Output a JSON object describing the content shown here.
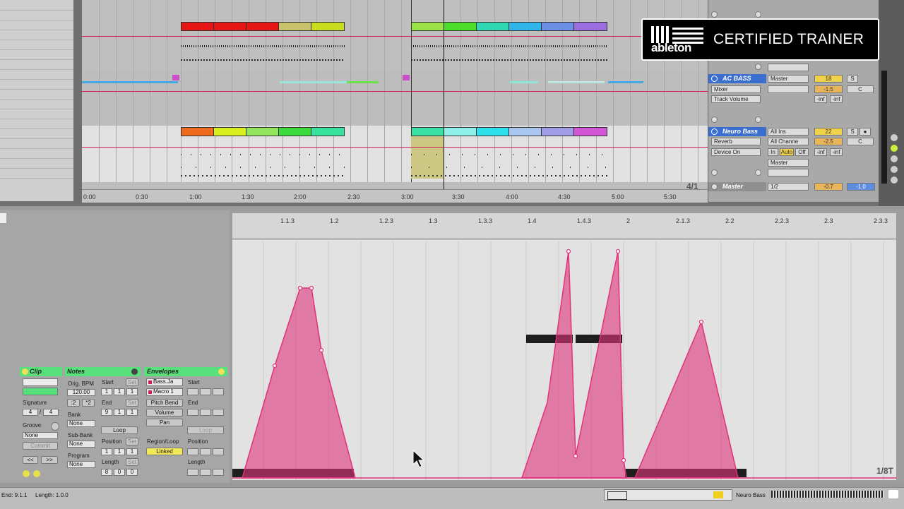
{
  "arrangement": {
    "ruler_times": [
      "0:00",
      "0:30",
      "1:00",
      "1:30",
      "2:00",
      "2:30",
      "3:00",
      "3:30",
      "4:00",
      "4:30",
      "5:00",
      "5:30"
    ],
    "position_label": "4/1",
    "tracks": [
      {
        "name": "AC BASS",
        "output": "Master",
        "device": "Mixer",
        "param": "Track Volume",
        "volume": "18",
        "pan": "-1.5",
        "solo": "S",
        "center": "C",
        "send_a": "-inf",
        "send_b": "-inf"
      },
      {
        "name": "Neuro Bass",
        "input": "All Ins",
        "channel": "All Channe",
        "device": "Reverb",
        "param": "Device On",
        "monitor_in": "In",
        "monitor_auto": "Auto",
        "monitor_off": "Off",
        "output": "Master",
        "volume": "22",
        "pan": "-2.5",
        "solo": "S",
        "center": "C",
        "send_a": "-inf",
        "send_b": "-inf"
      },
      {
        "name": "Master",
        "quantize": "1/2",
        "volume": "-0.7",
        "pan": "-1.0"
      }
    ]
  },
  "clip_panel": {
    "clip_header": "Clip",
    "signature_label": "Signature",
    "signature_num": "4",
    "signature_den": "4",
    "groove_label": "Groove",
    "groove_value": "None",
    "commit": "Commit",
    "nav_prev": "<<",
    "nav_next": ">>"
  },
  "notes_panel": {
    "header": "Notes",
    "orig_bpm_label": "Orig. BPM",
    "bpm": "120.00",
    "half": ":2",
    "double": "*2",
    "bank_label": "Bank",
    "bank_value": "None",
    "subbank_label": "Sub-Bank",
    "subbank_value": "None",
    "program_label": "Program",
    "program_value": "None",
    "start_label": "Start",
    "start_vals": [
      "1",
      "1",
      "1"
    ],
    "end_label": "End",
    "end_vals": [
      "9",
      "1",
      "1"
    ],
    "set": "Set",
    "loop": "Loop",
    "position_label": "Position",
    "position_vals": [
      "1",
      "1",
      "1"
    ],
    "length_label": "Length",
    "length_vals": [
      "8",
      "0",
      "0"
    ]
  },
  "envelopes_panel": {
    "header": "Envelopes",
    "device": "Bass.Ja",
    "control": "Macro 1",
    "pitch_bend": "Pitch Bend",
    "volume": "Volume",
    "pan": "Pan",
    "region_label": "Region/Loop",
    "linked": "Linked",
    "start_label": "Start",
    "end_label": "End",
    "loop": "Loop",
    "position_label": "Position",
    "length_label": "Length"
  },
  "envelope_editor": {
    "ruler": [
      "1.1.3",
      "1.2",
      "1.2.3",
      "1.3",
      "1.3.3",
      "1.4",
      "1.4.3",
      "2",
      "2.1.3",
      "2.2",
      "2.2.3",
      "2.3",
      "2.3.3"
    ],
    "grid_label": "1/8T",
    "color": "#e0337a"
  },
  "logo": {
    "wordmark": "ableton",
    "title": "CERTIFIED TRAINER"
  },
  "status": {
    "end": "End: 9.1.1",
    "length": "Length: 1.0.0",
    "track": "Neuro Bass"
  }
}
